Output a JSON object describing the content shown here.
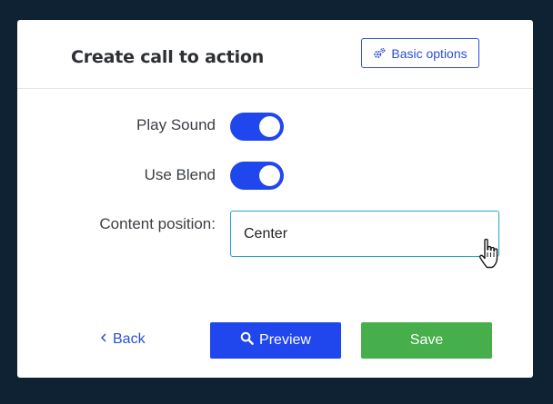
{
  "header": {
    "title": "Create call to action",
    "basic_options_label": "Basic options",
    "basic_options_icon": "gears-icon"
  },
  "settings": {
    "play_sound": {
      "label": "Play Sound",
      "enabled": true
    },
    "use_blend": {
      "label": "Use Blend",
      "enabled": true
    },
    "content_position": {
      "label": "Content position:",
      "value": "Center"
    }
  },
  "footer": {
    "back_label": "Back",
    "back_icon": "chevron-left-icon",
    "preview_label": "Preview",
    "preview_icon": "search-icon",
    "save_label": "Save"
  },
  "colors": {
    "background": "#0e2233",
    "accent": "#2046ee",
    "save": "#46ae4a",
    "select_border": "#26a2c9"
  }
}
